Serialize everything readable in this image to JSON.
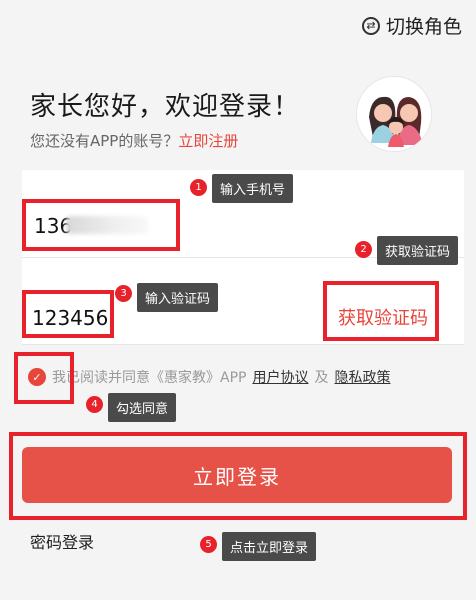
{
  "header": {
    "switch_role": "切换角色"
  },
  "greeting": "家长您好，欢迎登录！",
  "signup": {
    "prompt": "您还没有APP的账号？",
    "link": "立即注册"
  },
  "form": {
    "phone_value": "136",
    "code_value": "123456",
    "get_code": "获取验证码"
  },
  "agreement": {
    "text": "我已阅读并同意《惠家教》APP",
    "user_agreement": "用户协议",
    "and": "及",
    "privacy_policy": "隐私政策"
  },
  "login_button": "立即登录",
  "password_login": "密码登录",
  "annotations": [
    {
      "num": "1",
      "label": "输入手机号"
    },
    {
      "num": "2",
      "label": "获取验证码"
    },
    {
      "num": "3",
      "label": "输入验证码"
    },
    {
      "num": "4",
      "label": "勾选同意"
    },
    {
      "num": "5",
      "label": "点击立即登录"
    }
  ],
  "colors": {
    "accent": "#e8453c",
    "highlight": "#e8222b",
    "tip_bg": "#4a4a4a"
  },
  "icons": [
    "switch-role-icon",
    "family-avatar-icon",
    "check-icon"
  ]
}
